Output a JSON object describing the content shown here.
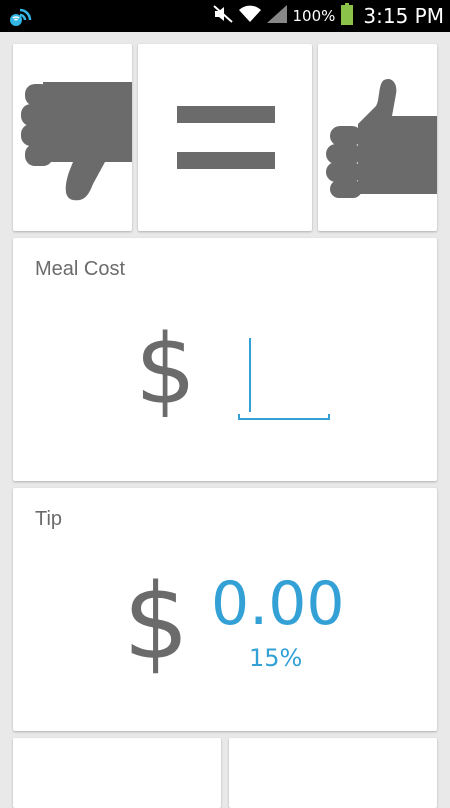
{
  "status_bar": {
    "battery_text": "100%",
    "time": "3:15 PM",
    "icons": [
      "notification-wifi-icon",
      "mute-icon",
      "wifi-icon",
      "signal-icon",
      "battery-icon"
    ]
  },
  "rating": {
    "buttons": [
      {
        "icon": "thumbs-down-icon"
      },
      {
        "icon": "equals-icon"
      },
      {
        "icon": "thumbs-up-icon"
      }
    ]
  },
  "meal_cost": {
    "title": "Meal Cost",
    "currency_symbol": "$",
    "value": ""
  },
  "tip": {
    "title": "Tip",
    "currency_symbol": "$",
    "amount": "0.00",
    "percent": "15%"
  },
  "colors": {
    "accent": "#33a1d6",
    "icon_gray": "#6b6b6b",
    "background": "#e9e9e9"
  }
}
